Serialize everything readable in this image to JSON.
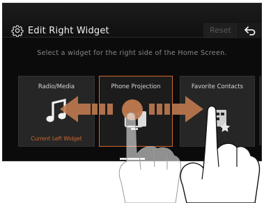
{
  "header": {
    "title": "Edit Right Widget",
    "reset_label": "Reset",
    "settings_icon": "gear-icon",
    "back_icon": "back-arrow-icon"
  },
  "subtitle": "Select a widget for the right side of the Home Screen.",
  "widgets": [
    {
      "label": "Radio/Media",
      "note": "Current Left Widget",
      "icon": "music-note-icon"
    },
    {
      "label": "Phone Projection",
      "icon": "phone-projection-icon",
      "selected": true
    },
    {
      "label": "Favorite Contacts",
      "icon": "favorite-contacts-icon"
    }
  ],
  "overlay": {
    "gesture": "swipe-left-right",
    "arrow_color": "#c07a4f",
    "highlight_color": "#d2692e"
  }
}
